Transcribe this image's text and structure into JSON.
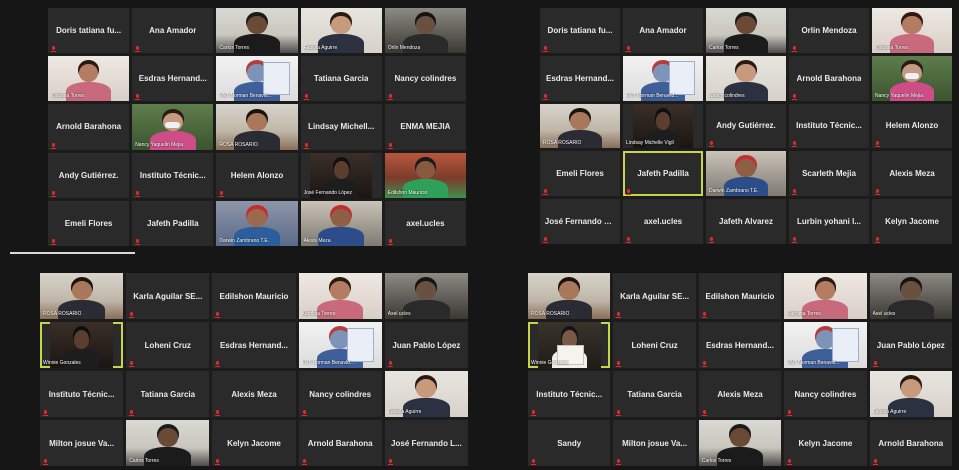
{
  "colors": {
    "background": "#161616",
    "tile": "#2a2a2a",
    "active_speaker_border": "#c8d44a",
    "muted_icon": "#e02a2a"
  },
  "icons": {
    "muted": "muted-mic-icon"
  },
  "panels": [
    {
      "id": "top-left",
      "tiles": [
        {
          "name": "Doris tatiana fu...",
          "video": false
        },
        {
          "name": "Ana Amador",
          "video": false
        },
        {
          "name": "",
          "video": true,
          "caption": "Carlos Torres",
          "scene": "man-office"
        },
        {
          "name": "",
          "video": true,
          "caption": "Fabiola Aguirre",
          "scene": "woman-light"
        },
        {
          "name": "",
          "video": true,
          "caption": "Orlin Mendoza",
          "scene": "dark-hair"
        },
        {
          "name": "",
          "video": true,
          "caption": "Karolina Torres",
          "scene": "woman-pink"
        },
        {
          "name": "Esdras Hernand...",
          "video": false
        },
        {
          "name": "",
          "video": true,
          "caption": "FNT Norman Benavid...",
          "scene": "poster"
        },
        {
          "name": "Tatiana Garcia",
          "video": false
        },
        {
          "name": "Nancy colindres",
          "video": false
        },
        {
          "name": "Arnold Barahona",
          "video": false
        },
        {
          "name": "",
          "video": true,
          "caption": "Nancy Yaquelin Mejia",
          "scene": "mask-woman"
        },
        {
          "name": "",
          "video": true,
          "caption": "ROSA ROSARIO",
          "scene": "woman-room"
        },
        {
          "name": "Lindsay Michell...",
          "video": false
        },
        {
          "name": "ENMA MEJIA",
          "video": false
        },
        {
          "name": "Andy Gutiérrez.",
          "video": false
        },
        {
          "name": "Instituto Técnic...",
          "video": false
        },
        {
          "name": "Helem Alonzo",
          "video": false
        },
        {
          "name": "",
          "video": true,
          "caption": "José Fernando López",
          "scene": "dark-face"
        },
        {
          "name": "",
          "video": true,
          "caption": "Edilshon Mauricio",
          "scene": "boy-green"
        },
        {
          "name": "Emeli Flores",
          "video": false
        },
        {
          "name": "Jafeth Padilla",
          "video": false
        },
        {
          "name": "",
          "video": true,
          "caption": "Darwin Zambrano T.E.",
          "scene": "cap-boy"
        },
        {
          "name": "",
          "video": true,
          "caption": "Alexis Meza",
          "scene": "red-cap"
        },
        {
          "name": "axel.ucles",
          "video": false
        }
      ]
    },
    {
      "id": "top-right",
      "tiles": [
        {
          "name": "Doris tatiana fu...",
          "video": false
        },
        {
          "name": "Ana Amador",
          "video": false
        },
        {
          "name": "",
          "video": true,
          "caption": "Carlos Torres",
          "scene": "man-office"
        },
        {
          "name": "Orlin Mendoza",
          "video": false
        },
        {
          "name": "",
          "video": true,
          "caption": "Karolina Torres",
          "scene": "woman-pink"
        },
        {
          "name": "Esdras Hernand...",
          "video": false
        },
        {
          "name": "",
          "video": true,
          "caption": "FNT Norman Benavid...",
          "scene": "poster"
        },
        {
          "name": "",
          "video": true,
          "caption": "Nancy colindres",
          "scene": "woman-light"
        },
        {
          "name": "Arnold Barahona",
          "video": false
        },
        {
          "name": "",
          "video": true,
          "caption": "Nancy Yaquelin Mejia",
          "scene": "mask-woman"
        },
        {
          "name": "",
          "video": true,
          "caption": "ROSA ROSARIO",
          "scene": "woman-room"
        },
        {
          "name": "",
          "video": true,
          "caption": "Lindsay Michelle Vigil",
          "scene": "dark-face"
        },
        {
          "name": "Andy Gutiérrez.",
          "video": false
        },
        {
          "name": "Instituto Técnic...",
          "video": false
        },
        {
          "name": "Helem Alonzo",
          "video": false
        },
        {
          "name": "Emeli Flores",
          "video": false
        },
        {
          "name": "Jafeth Padilla",
          "video": false,
          "active": true
        },
        {
          "name": "",
          "video": true,
          "caption": "Darwin Zambrano T.E.",
          "scene": "red-cap"
        },
        {
          "name": "Scarleth Mejia",
          "video": false
        },
        {
          "name": "Alexis Meza",
          "video": false
        },
        {
          "name": "José Fernando L...",
          "video": false
        },
        {
          "name": "axel.ucles",
          "video": false
        },
        {
          "name": "Jafeth Alvarez",
          "video": false
        },
        {
          "name": "Lurbin yohani l...",
          "video": false
        },
        {
          "name": "Kelyn Jacome",
          "video": false
        }
      ]
    },
    {
      "id": "bottom-left",
      "tiles": [
        {
          "name": "",
          "video": true,
          "caption": "ROSA ROSARIO",
          "scene": "woman-room"
        },
        {
          "name": "Karla Aguilar SE...",
          "video": false
        },
        {
          "name": "Edilshon Mauricio",
          "video": false
        },
        {
          "name": "",
          "video": true,
          "caption": "Karolina Torres",
          "scene": "woman-pink"
        },
        {
          "name": "",
          "video": true,
          "caption": "Axel ucles",
          "scene": "dark-hair"
        },
        {
          "name": "",
          "video": true,
          "caption": "Winnie Gonzales",
          "scene": "dark-face",
          "active": true
        },
        {
          "name": "Loheni Cruz",
          "video": false
        },
        {
          "name": "Esdras Hernand...",
          "video": false
        },
        {
          "name": "",
          "video": true,
          "caption": "FNT Norman Benavid...",
          "scene": "poster"
        },
        {
          "name": "Juan Pablo López",
          "video": false
        },
        {
          "name": "Instituto Técnic...",
          "video": false
        },
        {
          "name": "Tatiana Garcia",
          "video": false
        },
        {
          "name": "Alexis Meza",
          "video": false
        },
        {
          "name": "Nancy colindres",
          "video": false
        },
        {
          "name": "",
          "video": true,
          "caption": "Fabiola Aguirre",
          "scene": "woman-light"
        },
        {
          "name": "Milton josue Va...",
          "video": false
        },
        {
          "name": "",
          "video": true,
          "caption": "Carlos Torres",
          "scene": "man-office"
        },
        {
          "name": "Kelyn Jacome",
          "video": false
        },
        {
          "name": "Arnold Barahona",
          "video": false
        },
        {
          "name": "José Fernando L...",
          "video": false
        }
      ]
    },
    {
      "id": "bottom-right",
      "tiles": [
        {
          "name": "",
          "video": true,
          "caption": "ROSA ROSARIO",
          "scene": "woman-room"
        },
        {
          "name": "Karla Aguilar SE...",
          "video": false
        },
        {
          "name": "Edilshon Mauricio",
          "video": false
        },
        {
          "name": "",
          "video": true,
          "caption": "Karolina Torres",
          "scene": "woman-pink"
        },
        {
          "name": "",
          "video": true,
          "caption": "Axel ucles",
          "scene": "dark-hair"
        },
        {
          "name": "",
          "video": true,
          "caption": "Winnie Gonzales",
          "scene": "paper",
          "active": true
        },
        {
          "name": "Loheni Cruz",
          "video": false
        },
        {
          "name": "Esdras Hernand...",
          "video": false
        },
        {
          "name": "",
          "video": true,
          "caption": "FNT Norman Benavid...",
          "scene": "poster"
        },
        {
          "name": "Juan Pablo López",
          "video": false
        },
        {
          "name": "Instituto Técnic...",
          "video": false
        },
        {
          "name": "Tatiana Garcia",
          "video": false
        },
        {
          "name": "Alexis Meza",
          "video": false
        },
        {
          "name": "Nancy colindres",
          "video": false
        },
        {
          "name": "",
          "video": true,
          "caption": "Fabiola Aguirre",
          "scene": "woman-light"
        },
        {
          "name": "Sandy",
          "video": false
        },
        {
          "name": "Milton josue Va...",
          "video": false
        },
        {
          "name": "",
          "video": true,
          "caption": "Carlos Torres",
          "scene": "man-office"
        },
        {
          "name": "Kelyn Jacome",
          "video": false
        },
        {
          "name": "Arnold Barahona",
          "video": false
        }
      ]
    }
  ]
}
